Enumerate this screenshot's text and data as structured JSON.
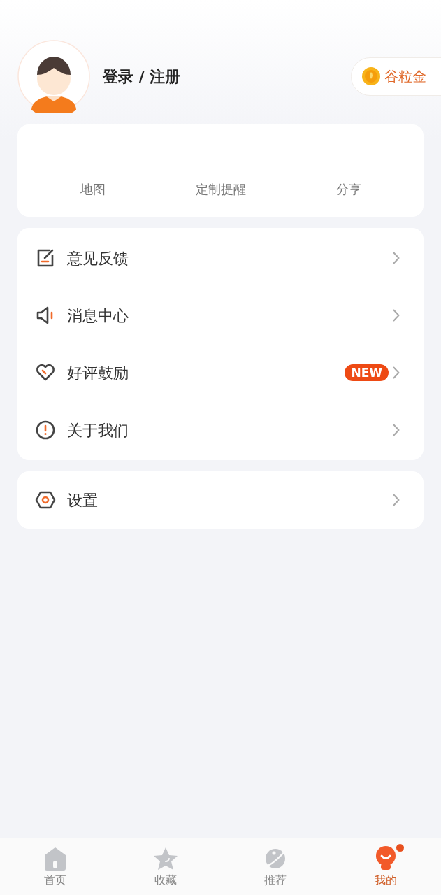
{
  "profile": {
    "login_label": "登录 / 注册",
    "coin_label": "谷粒金"
  },
  "quick_links": [
    "地图",
    "定制提醒",
    "分享"
  ],
  "menu": [
    {
      "kind": "edit",
      "label": "意见反馈"
    },
    {
      "kind": "speaker",
      "label": "消息中心"
    },
    {
      "kind": "heart",
      "label": "好评鼓励",
      "badge": "NEW"
    },
    {
      "kind": "info",
      "label": "关于我们"
    }
  ],
  "settings_menu": [
    {
      "kind": "settings",
      "label": "设置"
    }
  ],
  "tab_bar": [
    {
      "kind": "home",
      "label": "首页",
      "selected": false,
      "dot": false
    },
    {
      "kind": "star",
      "label": "收藏",
      "selected": false,
      "dot": false
    },
    {
      "kind": "planet",
      "label": "推荐",
      "selected": false,
      "dot": false
    },
    {
      "kind": "me",
      "label": "我的",
      "selected": true,
      "dot": true
    }
  ]
}
